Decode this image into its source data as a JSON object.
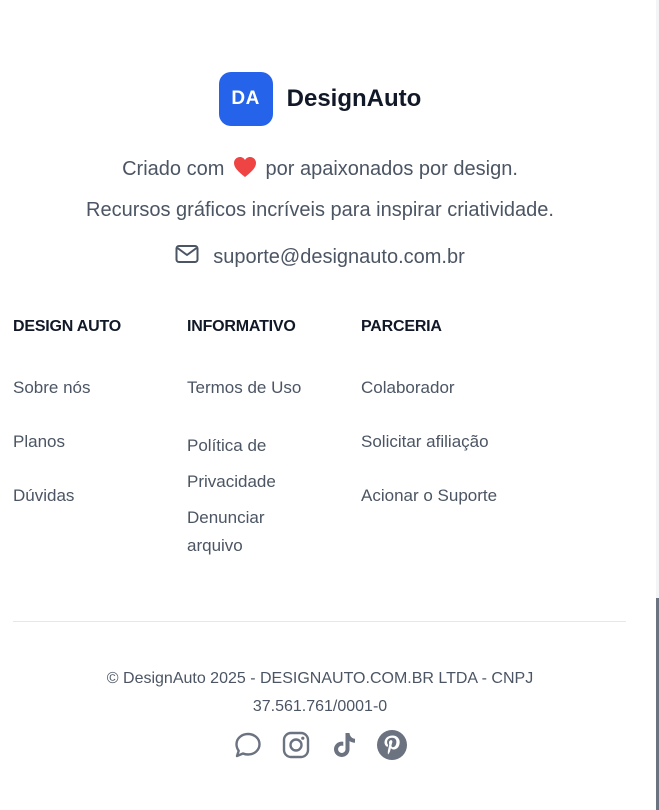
{
  "brand": {
    "badge": "DA",
    "name": "DesignAuto",
    "color": "#2563eb"
  },
  "tagline": {
    "line1_before": "Criado com",
    "line1_after": "por apaixonados por design.",
    "line2": "Recursos gráficos incríveis para inspirar criatividade."
  },
  "contact": {
    "email": "suporte@designauto.com.br"
  },
  "columns": [
    {
      "title": "DESIGN AUTO",
      "links": [
        "Sobre nós",
        "Planos",
        "Dúvidas"
      ]
    },
    {
      "title": "INFORMATIVO",
      "links": [
        "Termos de Uso",
        "Política de Privacidade",
        "Denunciar arquivo"
      ]
    },
    {
      "title": "PARCERIA",
      "links": [
        "Colaborador",
        "Solicitar afiliação",
        "Acionar o Suporte"
      ]
    }
  ],
  "footer": {
    "copyright": "© DesignAuto 2025 - DESIGNAUTO.COM.BR LTDA - CNPJ 37.561.761/0001-0"
  },
  "socials": [
    "chat-icon",
    "instagram-icon",
    "tiktok-icon",
    "pinterest-icon"
  ],
  "colors": {
    "heart": "#ef4444",
    "social_icon": "#6b7280"
  }
}
